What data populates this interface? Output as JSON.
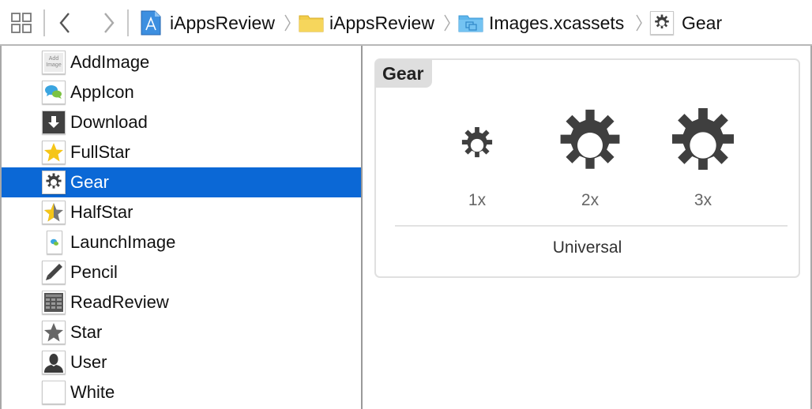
{
  "jumpbar": {
    "related_items_icon": "grid-related-items-icon",
    "back_icon": "chevron-left-icon",
    "forward_icon": "chevron-right-icon",
    "breadcrumbs": [
      {
        "label": "iAppsReview",
        "icon": "xcode-project-icon"
      },
      {
        "label": "iAppsReview",
        "icon": "yellow-folder-icon"
      },
      {
        "label": "Images.xcassets",
        "icon": "asset-catalog-icon"
      },
      {
        "label": "Gear",
        "icon": "gear-icon"
      }
    ]
  },
  "sidebar": {
    "selected": "Gear",
    "items": [
      {
        "label": "AddImage",
        "icon": "add-image-thumbnail",
        "thumb_text": "Add Image"
      },
      {
        "label": "AppIcon",
        "icon": "app-icon-thumbnail"
      },
      {
        "label": "Download",
        "icon": "download-icon"
      },
      {
        "label": "FullStar",
        "icon": "full-star-icon"
      },
      {
        "label": "Gear",
        "icon": "gear-icon"
      },
      {
        "label": "HalfStar",
        "icon": "half-star-icon"
      },
      {
        "label": "LaunchImage",
        "icon": "launch-image-thumbnail"
      },
      {
        "label": "Pencil",
        "icon": "pencil-icon"
      },
      {
        "label": "ReadReview",
        "icon": "read-review-icon"
      },
      {
        "label": "Star",
        "icon": "star-icon"
      },
      {
        "label": "User",
        "icon": "user-icon"
      },
      {
        "label": "White",
        "icon": "blank-white-thumbnail"
      }
    ]
  },
  "detail": {
    "asset_name": "Gear",
    "slots": [
      {
        "scale": "1x"
      },
      {
        "scale": "2x"
      },
      {
        "scale": "3x"
      }
    ],
    "idiom": "Universal"
  },
  "colors": {
    "selection": "#0b68d6",
    "gear": "#3f3f3f",
    "star_yellow": "#f5c518",
    "folder_yellow": "#f2cd4a",
    "asset_blue": "#5fb6ec"
  }
}
